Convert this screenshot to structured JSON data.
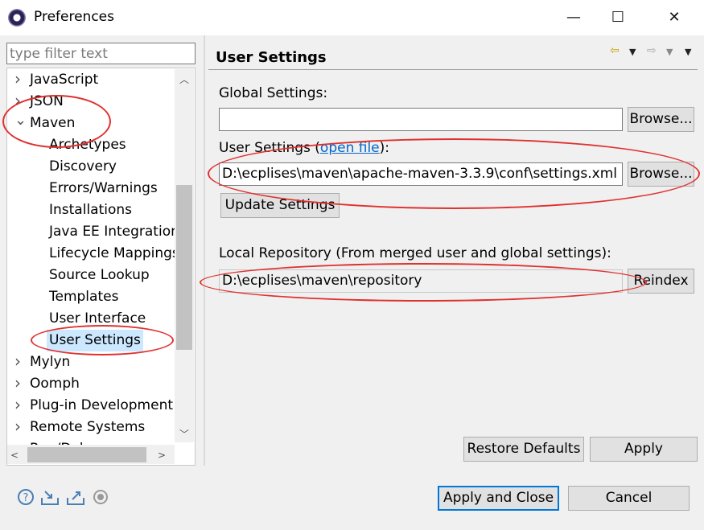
{
  "window": {
    "title": "Preferences",
    "minimize_glyph": "—",
    "maximize_glyph": "☐",
    "close_glyph": "✕"
  },
  "filter": {
    "placeholder": "type filter text"
  },
  "tree": {
    "items": [
      {
        "label": "JavaScript",
        "expanded": false,
        "level": 0
      },
      {
        "label": "JSON",
        "expanded": false,
        "level": 0
      },
      {
        "label": "Maven",
        "expanded": true,
        "level": 0
      },
      {
        "label": "Archetypes",
        "level": 1
      },
      {
        "label": "Discovery",
        "level": 1
      },
      {
        "label": "Errors/Warnings",
        "level": 1
      },
      {
        "label": "Installations",
        "level": 1
      },
      {
        "label": "Java EE Integration",
        "level": 1
      },
      {
        "label": "Lifecycle Mappings",
        "level": 1
      },
      {
        "label": "Source Lookup",
        "level": 1
      },
      {
        "label": "Templates",
        "level": 1
      },
      {
        "label": "User Interface",
        "level": 1
      },
      {
        "label": "User Settings",
        "level": 1,
        "selected": true
      },
      {
        "label": "Mylyn",
        "expanded": false,
        "level": 0
      },
      {
        "label": "Oomph",
        "expanded": false,
        "level": 0
      },
      {
        "label": "Plug-in Development",
        "expanded": false,
        "level": 0
      },
      {
        "label": "Remote Systems",
        "expanded": false,
        "level": 0
      },
      {
        "label": "Run/Debug",
        "expanded": false,
        "level": 0
      }
    ]
  },
  "page": {
    "title": "User Settings",
    "global_settings_label": "Global Settings:",
    "global_settings_value": "",
    "browse_label": "Browse...",
    "user_settings_label_prefix": "User Settings (",
    "user_settings_link": "open file",
    "user_settings_label_suffix": "):",
    "user_settings_value": "D:\\ecplises\\maven\\apache-maven-3.3.9\\conf\\settings.xml",
    "update_settings_label": "Update Settings",
    "local_repo_label": "Local Repository (From merged user and global settings):",
    "local_repo_value": "D:\\ecplises\\maven\\repository",
    "reindex_label": "Reindex",
    "restore_defaults_label": "Restore Defaults",
    "apply_label": "Apply"
  },
  "footer": {
    "apply_and_close_label": "Apply and Close",
    "cancel_label": "Cancel",
    "icons": [
      "help-icon",
      "import-icon",
      "export-icon",
      "record-icon"
    ]
  },
  "colors": {
    "selection": "#cce8ff",
    "link": "#0066cc",
    "annotation": "#e0312f",
    "primary_border": "#0078d7"
  }
}
